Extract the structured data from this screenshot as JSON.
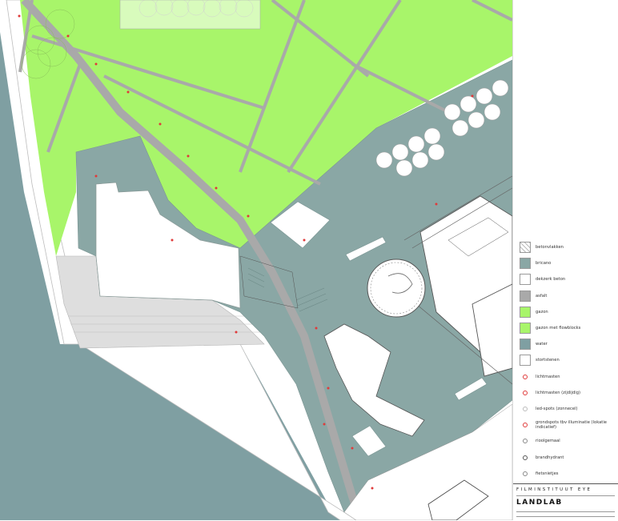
{
  "legend": {
    "items": [
      {
        "label": "betonvlakken",
        "icon": "hatched-concrete-swatch",
        "color": "#ffffff"
      },
      {
        "label": "bricano",
        "icon": "bricano-swatch",
        "color": "#8aa7a5"
      },
      {
        "label": "dekzerk beton",
        "icon": "dekzerk-beton-swatch",
        "color": "#ffffff"
      },
      {
        "label": "asfalt",
        "icon": "asphalt-swatch",
        "color": "#a9a9a9"
      },
      {
        "label": "gazon",
        "icon": "lawn-swatch",
        "color": "#a8f56a"
      },
      {
        "label": "gazon met flowblocks",
        "icon": "lawn-flowblocks-swatch",
        "color": "#a8f56a"
      },
      {
        "label": "water",
        "icon": "water-swatch",
        "color": "#7f9fa2"
      },
      {
        "label": "stortstenen",
        "icon": "riprap-swatch",
        "color": "#ffffff"
      },
      {
        "label": "lichtmasten",
        "icon": "light-mast-icon",
        "color": "#e03a3a"
      },
      {
        "label": "lichtmasten (zijdijdig)",
        "icon": "light-mast-double-icon",
        "color": "#e03a3a"
      },
      {
        "label": "led-spots (zonnecel)",
        "icon": "led-spot-icon",
        "color": "#bbbbbb"
      },
      {
        "label": "grondspots tbv illuminatie (lokatie indicatief)",
        "icon": "ground-spot-icon",
        "color": "#e03a3a"
      },
      {
        "label": "rioolgemaal",
        "icon": "sewage-pump-icon",
        "color": "#888888"
      },
      {
        "label": "brandhydrant",
        "icon": "fire-hydrant-icon",
        "color": "#555555"
      },
      {
        "label": "fietsnietjes",
        "icon": "bike-rack-icon",
        "color": "#888888"
      }
    ]
  },
  "titleblock": {
    "project": "FILMINSTITUUT EYE",
    "firm": "LANDLAB"
  },
  "colors": {
    "lawn": "#a8f56a",
    "water": "#7f9fa2",
    "bricano": "#8aa7a5",
    "path": "#a9a9a9",
    "concrete": "#dedede",
    "marker": "#e03a3a"
  }
}
